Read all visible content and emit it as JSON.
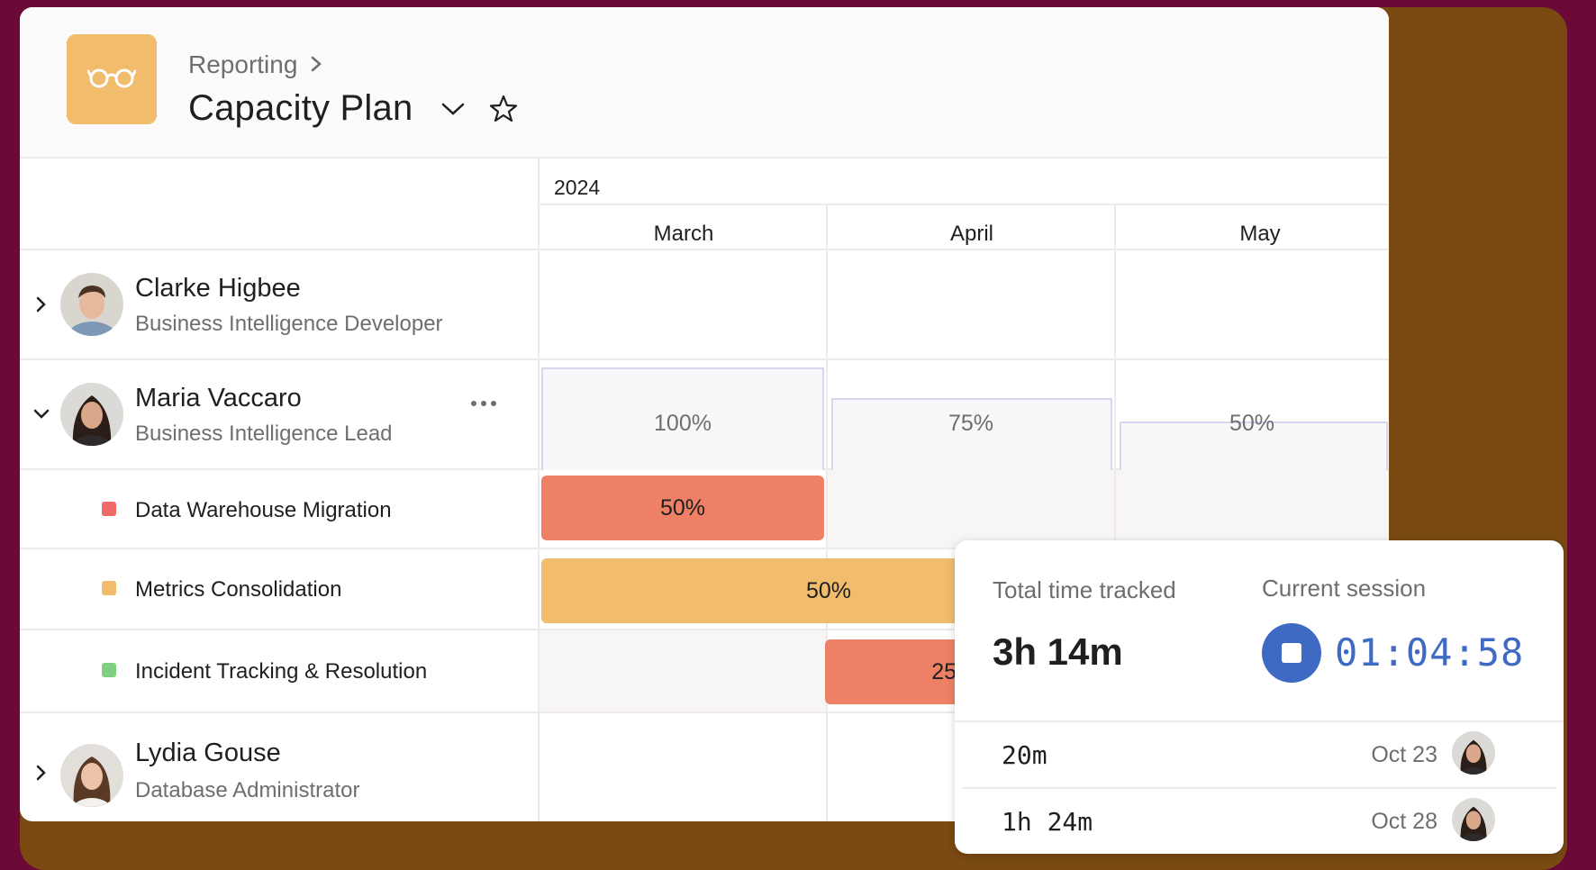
{
  "header": {
    "breadcrumb": "Reporting",
    "title": "Capacity Plan",
    "logo_color": "#f1bd6c"
  },
  "timeline": {
    "year": "2024",
    "months": [
      "March",
      "April",
      "May"
    ]
  },
  "people": [
    {
      "name": "Clarke Higbee",
      "role": "Business Intelligence Developer",
      "expanded": false
    },
    {
      "name": "Maria Vaccaro",
      "role": "Business Intelligence Lead",
      "expanded": true,
      "capacity": [
        "100%",
        "75%",
        "50%"
      ],
      "capacity_values": [
        100,
        75,
        50
      ]
    },
    {
      "name": "Lydia Gouse",
      "role": "Database Administrator",
      "expanded": false
    }
  ],
  "projects": [
    {
      "name": "Data Warehouse Migration",
      "color": "#f06a6a",
      "allocation": "50%"
    },
    {
      "name": "Metrics Consolidation",
      "color": "#f1bd6c",
      "allocation": "50%"
    },
    {
      "name": "Incident Tracking & Resolution",
      "color": "#7fd07f",
      "allocation": "25"
    }
  ],
  "tracker": {
    "total_label": "Total time tracked",
    "total_value": "3h 14m",
    "session_label": "Current session",
    "session_timer": "01:04:58",
    "accent": "#3f6ac4",
    "entries": [
      {
        "duration": "20m",
        "date": "Oct 23"
      },
      {
        "duration": "1h 24m",
        "date": "Oct 28"
      }
    ]
  }
}
